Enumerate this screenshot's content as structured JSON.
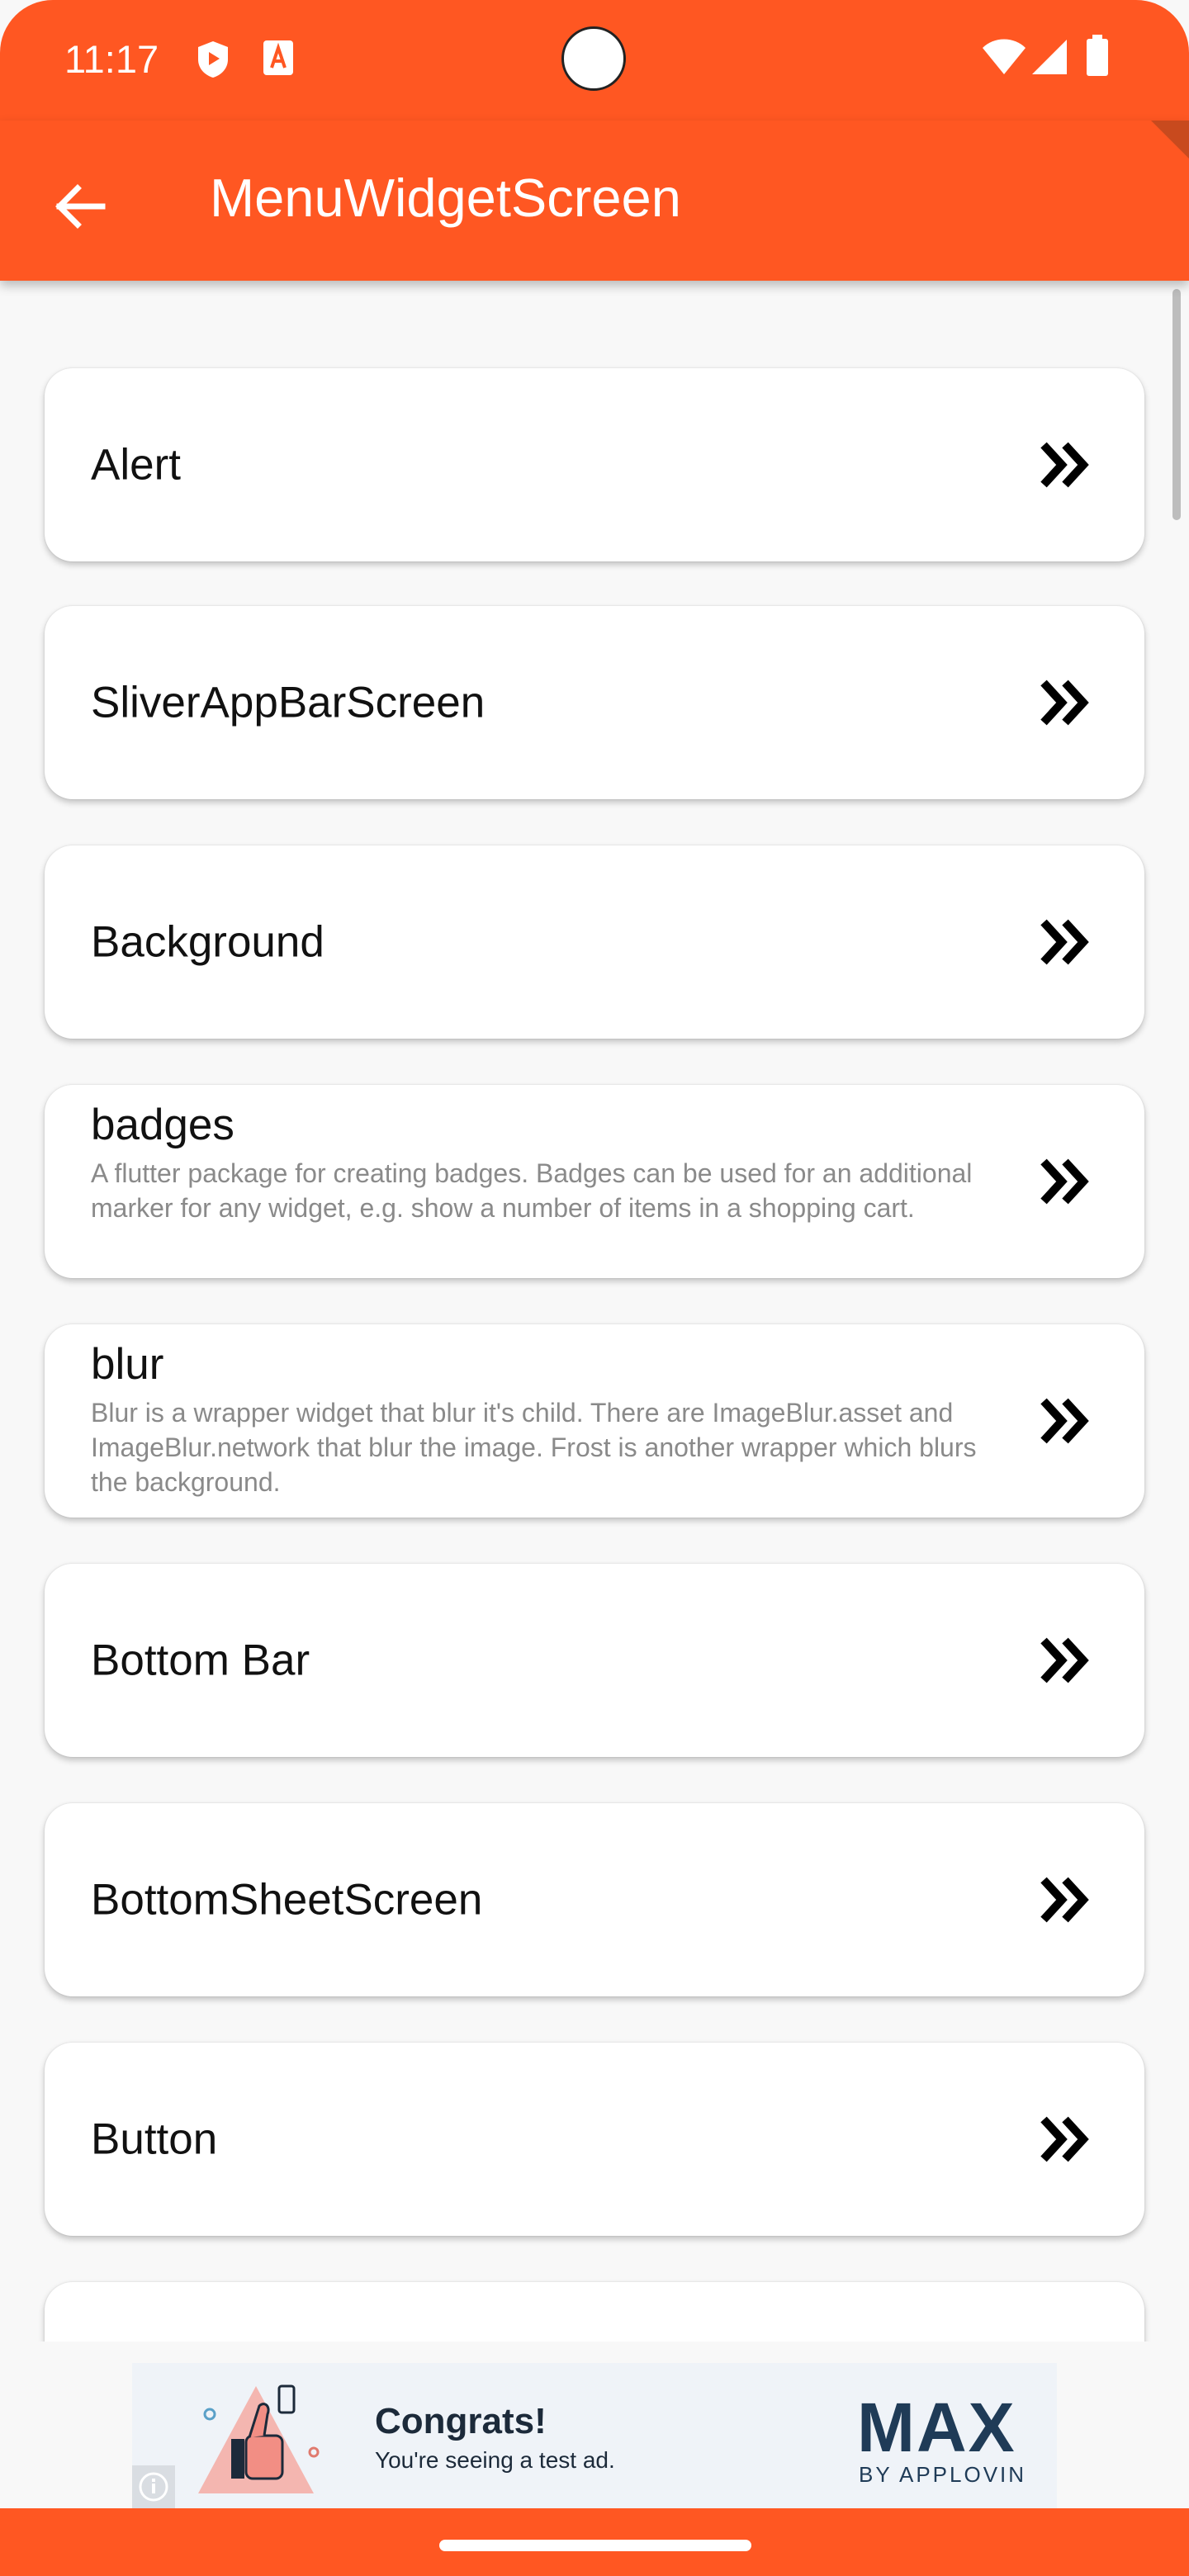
{
  "status_bar": {
    "time": "11:17",
    "icons": [
      "shield-notification-icon",
      "a-notification-icon",
      "wifi-icon",
      "signal-icon",
      "battery-icon"
    ]
  },
  "app_bar": {
    "title": "MenuWidgetScreen",
    "back_icon": "arrow-left-icon",
    "color": "#FF5722"
  },
  "menu_items": [
    {
      "title": "Alert",
      "subtitle": ""
    },
    {
      "title": "SliverAppBarScreen",
      "subtitle": ""
    },
    {
      "title": "Background",
      "subtitle": ""
    },
    {
      "title": "badges",
      "subtitle": "A flutter package for creating badges. Badges can be used for an additional marker for any widget, e.g. show a number of items in a shopping cart."
    },
    {
      "title": "blur",
      "subtitle": "Blur is a wrapper widget that blur it's child. There are ImageBlur.asset and ImageBlur.network that blur the image. Frost is another wrapper which blurs the background."
    },
    {
      "title": "Bottom Bar",
      "subtitle": ""
    },
    {
      "title": "BottomSheetScreen",
      "subtitle": ""
    },
    {
      "title": "Button",
      "subtitle": ""
    },
    {
      "title": "",
      "subtitle": ""
    }
  ],
  "chevron_icon": "double-chevron-right-icon",
  "ad": {
    "headline": "Congrats!",
    "subtext": "You're seeing a test ad.",
    "brand": "MAX",
    "brand_sub": "BY APPLOVIN"
  }
}
